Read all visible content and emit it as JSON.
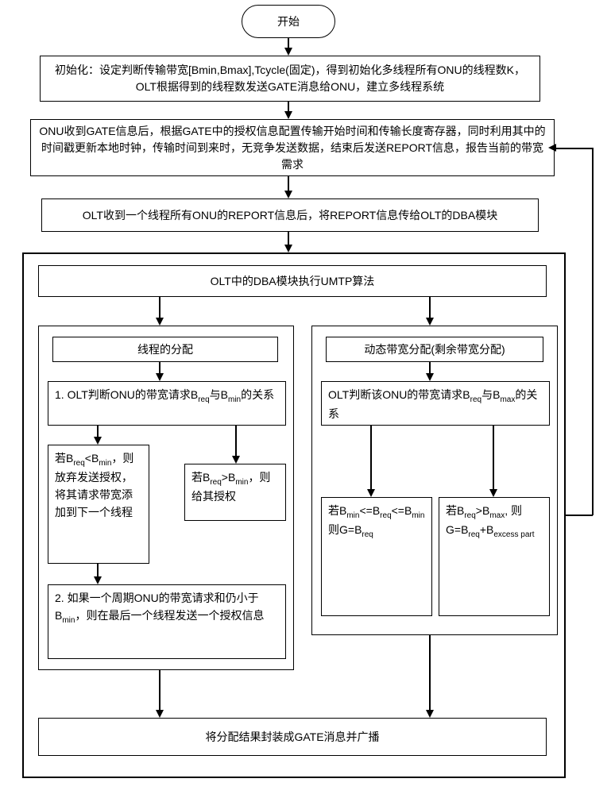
{
  "start": "开始",
  "step_init": "初始化：设定判断传输带宽[Bmin,Bmax],Tcycle(固定)，得到初始化多线程所有ONU的线程数K，OLT根据得到的线程数发送GATE消息给ONU，建立多线程系统",
  "step_onu": "ONU收到GATE信息后，根据GATE中的授权信息配置传输开始时间和传输长度寄存器，同时利用其中的时间戳更新本地时钟，传输时间到来时，无竞争发送数据，结束后发送REPORT信息，报告当前的带宽需求",
  "step_olt_report": "OLT收到一个线程所有ONU的REPORT信息后，将REPORT信息传给OLT的DBA模块",
  "umtp_title": "OLT中的DBA模块执行UMTP算法",
  "left_panel_title": "线程的分配",
  "left_rule1": "1. OLT判断ONU的带宽请求Breq与Bmin的关系",
  "left_case_low": "若Breq<Bmin，则放弃发送授权，将其请求带宽添加到下一个线程",
  "left_case_high": "若Breq>Bmin，则给其授权",
  "left_rule2": "2. 如果一个周期ONU的带宽请求和仍小于Bmin，则在最后一个线程发送一个授权信息",
  "right_panel_title": "动态带宽分配(剩余带宽分配)",
  "right_rule": "OLT判断该ONU的带宽请求Breq与Bmax的关系",
  "right_case_mid": "若Bmin<=Breq<=Bmin则G=Breq",
  "right_case_high": "若Breq>Bmax, 则G=Breq+Bexcess part",
  "broadcast": "将分配结果封装成GATE消息并广播",
  "chart_data": {
    "type": "table",
    "title": "Flowchart: UMTP dynamic bandwidth allocation procedure",
    "nodes": [
      {
        "id": "start",
        "kind": "terminator",
        "label": "开始"
      },
      {
        "id": "init",
        "kind": "process",
        "label": "初始化：设定判断传输带宽[Bmin,Bmax],Tcycle(固定)，得到初始化多线程所有ONU的线程数K，OLT根据得到的线程数发送GATE消息给ONU，建立多线程系统"
      },
      {
        "id": "onu_gate",
        "kind": "process",
        "label": "ONU收到GATE信息后，根据GATE中的授权信息配置传输开始时间和传输长度寄存器，同时利用其中的时间戳更新本地时钟，传输时间到来时，无竞争发送数据，结束后发送REPORT信息，报告当前的带宽需求"
      },
      {
        "id": "olt_report",
        "kind": "process",
        "label": "OLT收到一个线程所有ONU的REPORT信息后，将REPORT信息传给OLT的DBA模块"
      },
      {
        "id": "umtp",
        "kind": "subprocess",
        "label": "OLT中的DBA模块执行UMTP算法",
        "children": [
          "thread_alloc",
          "dba_alloc",
          "broadcast"
        ]
      },
      {
        "id": "thread_alloc",
        "kind": "branch",
        "label": "线程的分配",
        "rule": "OLT判断ONU的带宽请求Breq与Bmin的关系",
        "cases": [
          {
            "cond": "Breq<Bmin",
            "action": "放弃发送授权，将其请求带宽添加到下一个线程"
          },
          {
            "cond": "Breq>Bmin",
            "action": "给其授权"
          }
        ],
        "note": "如果一个周期ONU的带宽请求和仍小于Bmin，则在最后一个线程发送一个授权信息"
      },
      {
        "id": "dba_alloc",
        "kind": "branch",
        "label": "动态带宽分配(剩余带宽分配)",
        "rule": "OLT判断该ONU的带宽请求Breq与Bmax的关系",
        "cases": [
          {
            "cond": "Bmin<=Breq<=Bmin",
            "action": "G=Breq"
          },
          {
            "cond": "Breq>Bmax",
            "action": "G=Breq+Bexcess part"
          }
        ]
      },
      {
        "id": "broadcast",
        "kind": "process",
        "label": "将分配结果封装成GATE消息并广播"
      }
    ],
    "edges": [
      {
        "from": "start",
        "to": "init"
      },
      {
        "from": "init",
        "to": "onu_gate"
      },
      {
        "from": "onu_gate",
        "to": "olt_report"
      },
      {
        "from": "olt_report",
        "to": "umtp"
      },
      {
        "from": "umtp",
        "to": "thread_alloc"
      },
      {
        "from": "umtp",
        "to": "dba_alloc"
      },
      {
        "from": "thread_alloc",
        "to": "broadcast"
      },
      {
        "from": "dba_alloc",
        "to": "broadcast"
      },
      {
        "from": "broadcast",
        "to": "onu_gate",
        "kind": "loop-back"
      }
    ]
  }
}
